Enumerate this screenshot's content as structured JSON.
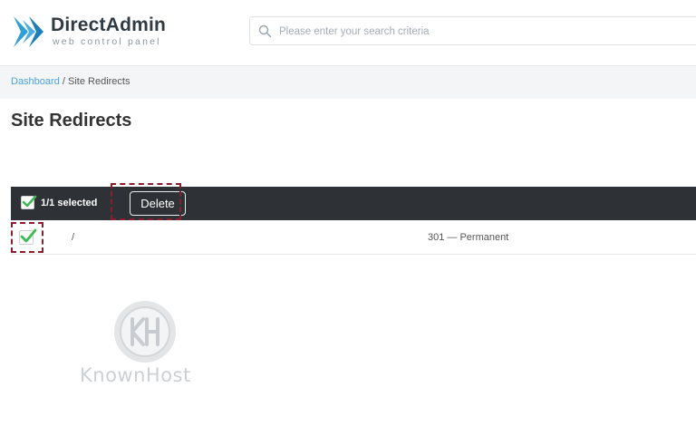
{
  "header": {
    "brand_name": "DirectAdmin",
    "brand_tagline": "web control panel",
    "search": {
      "placeholder": "Please enter your search criteria",
      "value": ""
    }
  },
  "breadcrumb": {
    "root": "Dashboard",
    "separator": " / ",
    "current": "Site Redirects"
  },
  "page": {
    "title": "Site Redirects"
  },
  "toolbar": {
    "selected_count": "1/1 selected",
    "delete_label": "Delete",
    "select_all_checked": true
  },
  "table": {
    "rows": [
      {
        "checked": true,
        "path": "/",
        "type": "301 — Permanent"
      }
    ]
  },
  "watermark": {
    "text": "KnownHost"
  },
  "colors": {
    "brand": "#2f9fd8",
    "link": "#4aa3df",
    "toolbar_bg": "#2e3236",
    "check_green": "#3cba54",
    "highlight": "#8b1d2c"
  },
  "icons": {
    "logo": "directadmin-logo-icon",
    "search": "search-icon",
    "checkbox": "checkbox-checked-icon",
    "watermark": "knownhost-logo-icon"
  }
}
